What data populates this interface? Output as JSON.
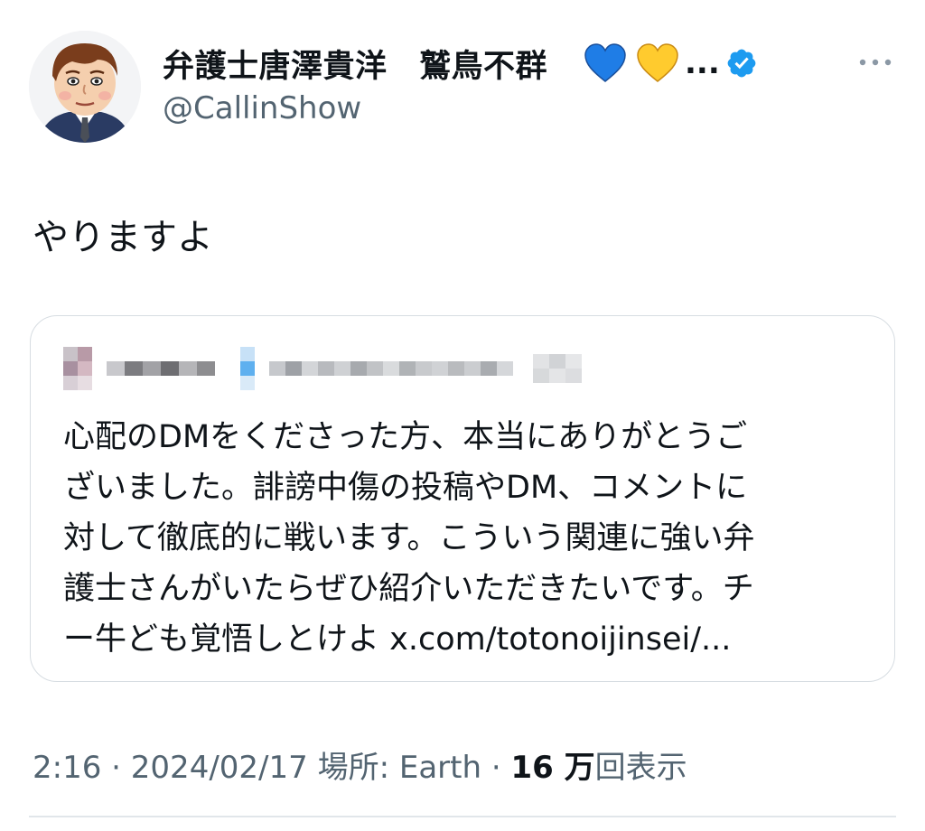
{
  "author": {
    "display_name": "弁護士唐澤貴洋　鷲鳥不群",
    "truncation": "...",
    "handle": "@CallinShow",
    "icons": [
      "blue-heart-icon",
      "yellow-heart-icon",
      "verified-badge-icon"
    ]
  },
  "tweet": {
    "text": "やりますよ"
  },
  "quote": {
    "lines": [
      "心配のDMをくださった方、本当にありがとうご",
      "ざいました。誹謗中傷の投稿やDM、コメントに",
      "対して徹底的に戦います。こういう関連に強い弁",
      "護士さんがいたらぜひ紹介いただきたいです。チ",
      "ー牛ども覚悟しとけよ x.com/totonoijinsei/..."
    ]
  },
  "meta": {
    "time": "2:16",
    "sep1": " · ",
    "date": "2024/02/17",
    "location_label": " 場所: Earth",
    "sep2": " · ",
    "views_count": "16 万",
    "views_label": "回表示"
  },
  "colors": {
    "text_primary": "#0f1419",
    "text_secondary": "#536471",
    "verified": "#1d9bf0",
    "border": "#d7dde2"
  }
}
